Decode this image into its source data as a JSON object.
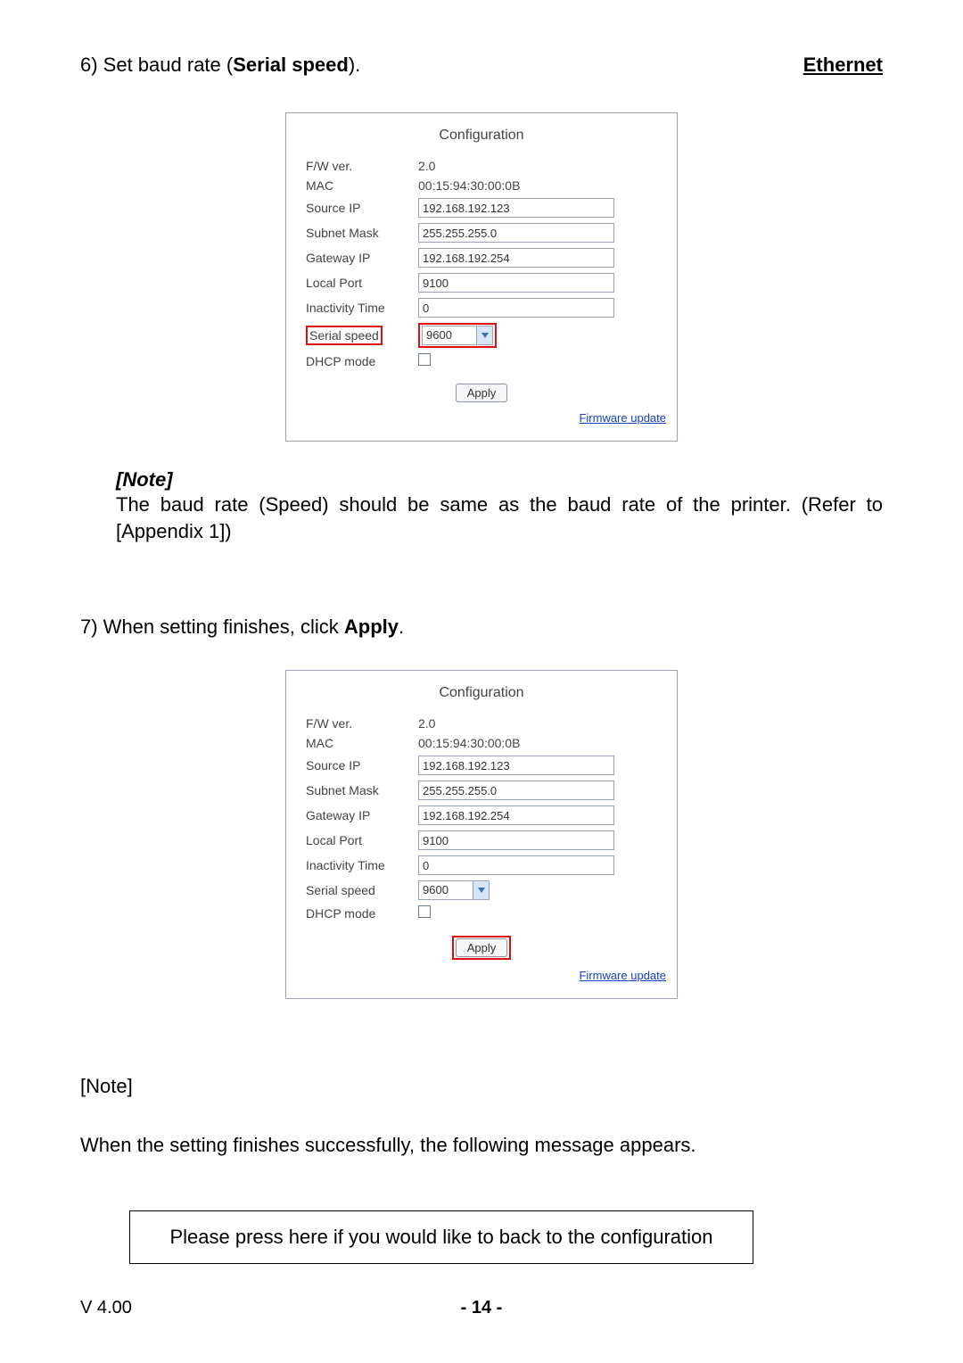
{
  "header": {
    "title_right": "Ethernet"
  },
  "step6": {
    "prefix": "6) Set baud rate (",
    "bold": "Serial speed",
    "suffix": ")."
  },
  "config1": {
    "title": "Configuration",
    "fw_ver_label": "F/W ver.",
    "fw_ver": "2.0",
    "mac_label": "MAC",
    "mac": "00:15:94:30:00:0B",
    "source_ip_label": "Source IP",
    "source_ip": "192.168.192.123",
    "subnet_label": "Subnet Mask",
    "subnet": "255.255.255.0",
    "gateway_label": "Gateway IP",
    "gateway": "192.168.192.254",
    "local_port_label": "Local Port",
    "local_port": "9100",
    "inactivity_label": "Inactivity Time",
    "inactivity": "0",
    "serial_label": "Serial speed",
    "serial": "9600",
    "dhcp_label": "DHCP mode",
    "apply_label": "Apply",
    "fw_link": "Firmware update"
  },
  "note1": {
    "head": "[Note]",
    "body": "The baud rate (Speed) should be same as the baud rate of the printer. (Refer to [Appendix 1])"
  },
  "step7": {
    "prefix": "7) When setting finishes, click ",
    "bold": "Apply",
    "suffix": "."
  },
  "config2": {
    "title": "Configuration",
    "fw_ver_label": "F/W ver.",
    "fw_ver": "2.0",
    "mac_label": "MAC",
    "mac": "00:15:94:30:00:0B",
    "source_ip_label": "Source IP",
    "source_ip": "192.168.192.123",
    "subnet_label": "Subnet Mask",
    "subnet": "255.255.255.0",
    "gateway_label": "Gateway IP",
    "gateway": "192.168.192.254",
    "local_port_label": "Local Port",
    "local_port": "9100",
    "inactivity_label": "Inactivity Time",
    "inactivity": "0",
    "serial_label": "Serial speed",
    "serial": "9600",
    "dhcp_label": "DHCP mode",
    "apply_label": "Apply",
    "fw_link": "Firmware update"
  },
  "note2": {
    "head": "[Note]",
    "body": "When the setting finishes successfully, the following message appears."
  },
  "message": "Please press here if you would like to back to the configuration",
  "footer": {
    "ver": "V 4.00",
    "page": "- 14 -"
  }
}
